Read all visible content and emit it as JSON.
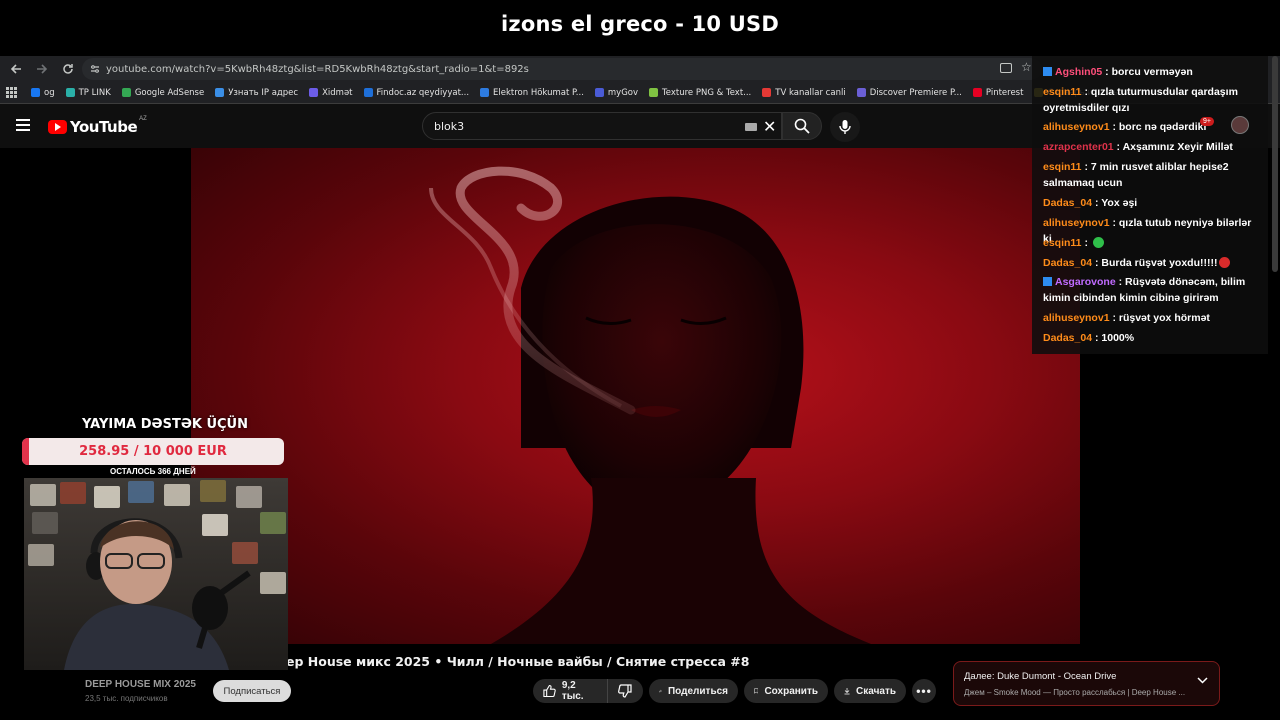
{
  "overlay_title": "izons el greco - 10 USD",
  "browser": {
    "url": "youtube.com/watch?v=5KwbRh48ztg&list=RD5KwbRh48ztg&start_radio=1&t=892s",
    "bookmarks": [
      {
        "label": "og",
        "color": "#1877f2"
      },
      {
        "label": "TP LINK",
        "color": "#2ab0a8"
      },
      {
        "label": "Google AdSense",
        "color": "#34a853"
      },
      {
        "label": "Узнать IP адрес",
        "color": "#3a8ee6"
      },
      {
        "label": "Xidmət",
        "color": "#6c5ce7"
      },
      {
        "label": "Findoc.az qeydiyyat...",
        "color": "#1e6fd9"
      },
      {
        "label": "Elektron Hökumat P...",
        "color": "#2d7be0"
      },
      {
        "label": "myGov",
        "color": "#4a5bd6"
      },
      {
        "label": "Texture PNG & Text...",
        "color": "#7fc242"
      },
      {
        "label": "TV kanallar canli",
        "color": "#e53935"
      },
      {
        "label": "Discover Premiere P...",
        "color": "#6b5fd6"
      },
      {
        "label": "Pinterest",
        "color": "#e60023"
      },
      {
        "label": "Словарь игровых т...",
        "color": "#e2d03a"
      }
    ]
  },
  "youtube": {
    "logo_text": "YouTube",
    "region": "AZ",
    "search_value": "blok3"
  },
  "video": {
    "title": "ep House микс 2025 • Чилл / Ночные вайбы / Снятие стресса #8",
    "channel": "DEEP HOUSE MIX 2025",
    "subscribers": "23,5 тыс. подписчиков",
    "subscribe_label": "Подписаться",
    "likes": "9,2 тыс.",
    "share_label": "Поделиться",
    "save_label": "Сохранить",
    "download_label": "Скачать"
  },
  "up_next": {
    "title": "Далее: Duke Dumont - Ocean Drive",
    "subtitle": "Джем – Smoke Mood — Просто расслабься | Deep House ..."
  },
  "donation": {
    "title": "YAYIMA DƏSTƏK ÜÇÜN",
    "amount": "258.95 / 10 000 EUR",
    "progress": 0.026,
    "days_left": "ОСТАЛОСЬ 366 ДНЕЙ"
  },
  "chat": [
    {
      "user": "Agshin05",
      "color": "#ff4f7b",
      "text": "borcu verməyən",
      "badge": true
    },
    {
      "user": "esqin11",
      "color": "#ff8c1a",
      "text": "qızla tuturmusdular qardaşım oyretmisdiler qızı",
      "badge": false
    },
    {
      "user": "alihuseynov1",
      "color": "#ff8c1a",
      "text": "borc nə qədərdiki",
      "badge": false
    },
    {
      "user": "azrapcenter01",
      "color": "#e0334b",
      "text": "Axşamınız Xeyir Millət",
      "badge": false
    },
    {
      "user": "esqin11",
      "color": "#ff8c1a",
      "text": "7 min rusvet aliblar hepise2 salmamaq ucun",
      "badge": false
    },
    {
      "user": "Dadas_04",
      "color": "#ff8c1a",
      "text": "Yox əşi",
      "badge": false
    },
    {
      "user": "alihuseynov1",
      "color": "#ff8c1a",
      "text": "qızla tutub neyniyə bilərlər ki",
      "badge": false
    },
    {
      "user": "esqin11",
      "color": "#ff8c1a",
      "text": "",
      "emote": "green",
      "badge": false
    },
    {
      "user": "Dadas_04",
      "color": "#ff8c1a",
      "text": "Burda rüşvət yoxdu!!!!!",
      "emote": "red",
      "badge": false
    },
    {
      "user": "Asgarovone",
      "color": "#c06bff",
      "text": "Rüşvətə dönəcəm, bilim kimin cibindən kimin cibinə girirəm",
      "badge": true
    },
    {
      "user": "alihuseynov1",
      "color": "#ff8c1a",
      "text": "rüşvət yox hörmət",
      "badge": false
    },
    {
      "user": "Dadas_04",
      "color": "#ff8c1a",
      "text": "1000%",
      "badge": false
    }
  ],
  "notifications_badge": "9+"
}
